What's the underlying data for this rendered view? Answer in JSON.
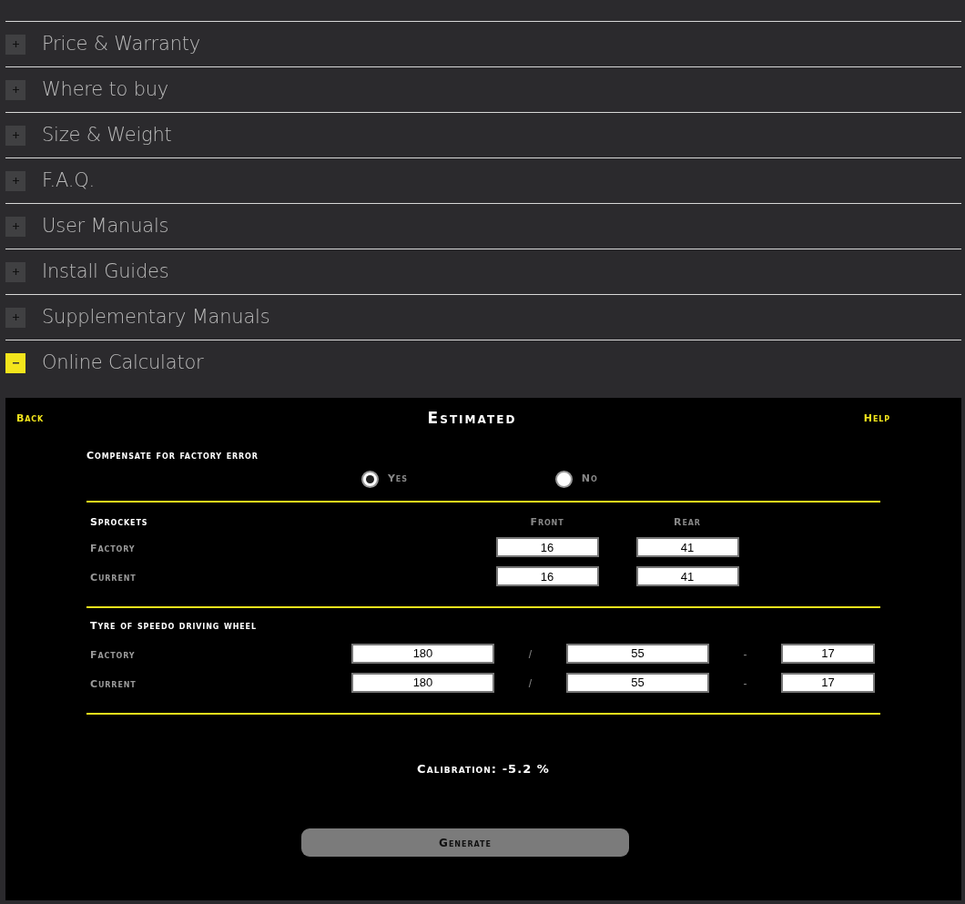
{
  "accordion": [
    {
      "label": "Price & Warranty",
      "expanded": false
    },
    {
      "label": "Where to buy",
      "expanded": false
    },
    {
      "label": "Size & Weight",
      "expanded": false
    },
    {
      "label": "F.A.Q.",
      "expanded": false
    },
    {
      "label": "User Manuals",
      "expanded": false
    },
    {
      "label": "Install Guides",
      "expanded": false
    },
    {
      "label": "Supplementary Manuals",
      "expanded": false
    },
    {
      "label": "Online Calculator",
      "expanded": true
    }
  ],
  "calculator": {
    "back": "Back",
    "title": "Estimated",
    "help": "Help",
    "compensate": {
      "label": "Compensate for factory error",
      "options": [
        {
          "label": "Yes",
          "selected": true
        },
        {
          "label": "No",
          "selected": false
        }
      ]
    },
    "sprockets": {
      "heading": "Sprockets",
      "columns": [
        "Front",
        "Rear"
      ],
      "rows": [
        {
          "label": "Factory",
          "values": [
            "16",
            "41"
          ]
        },
        {
          "label": "Current",
          "values": [
            "16",
            "41"
          ]
        }
      ]
    },
    "tyre": {
      "heading": "Tyre of speedo driving wheel",
      "separators": [
        "/",
        "-"
      ],
      "rows": [
        {
          "label": "Factory",
          "values": [
            "180",
            "55",
            "17"
          ]
        },
        {
          "label": "Current",
          "values": [
            "180",
            "55",
            "17"
          ]
        }
      ]
    },
    "calibration": "Calibration: -5.2 %",
    "generate": "Generate"
  }
}
